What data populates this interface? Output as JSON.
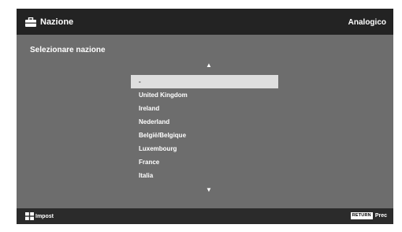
{
  "header": {
    "title": "Nazione",
    "title_icon": "toolbox-icon",
    "mode": "Analogico"
  },
  "main": {
    "heading": "Selezionare nazione",
    "scroll_up_icon": "triangle-up-icon",
    "scroll_down_icon": "triangle-down-icon",
    "countries": [
      {
        "label": "-",
        "selected": true
      },
      {
        "label": "United Kingdom",
        "selected": false
      },
      {
        "label": "Ireland",
        "selected": false
      },
      {
        "label": "Nederland",
        "selected": false
      },
      {
        "label": "België/Belgique",
        "selected": false
      },
      {
        "label": "Luxembourg",
        "selected": false
      },
      {
        "label": "France",
        "selected": false
      },
      {
        "label": "Italia",
        "selected": false
      }
    ]
  },
  "footer": {
    "left_icon": "dpad-icon",
    "left_label": "Impost",
    "return_key": "RETURN",
    "right_label": "Prec"
  },
  "colors": {
    "background": "#6d6d6d",
    "header": "#232323",
    "footer": "#2b2b2b",
    "highlight": "#dedede",
    "text": "#ffffff"
  }
}
